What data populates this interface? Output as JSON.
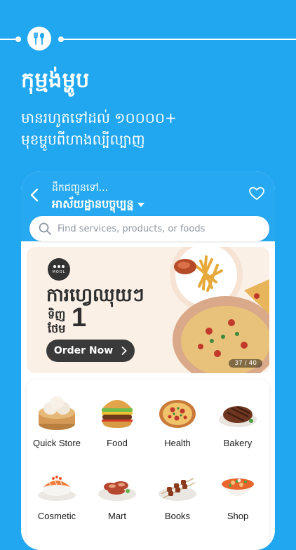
{
  "headline": "កុម្មង់ម្ហូប",
  "subtitle_line1": "មានរហូតទៅដល់ ១០០០០+",
  "subtitle_line2": "មុខម្ហូបពីហាងល្បីល្បាញ",
  "header": {
    "deliver_label": "ដឹកជញ្ជូនទៅ...",
    "address": "អាស័យដ្ឋានបច្ចុប្បន្ន"
  },
  "search": {
    "placeholder": "Find services, products, or foods"
  },
  "banner": {
    "brand": "MOOL",
    "title": "ការហ្វេឈុយៗ",
    "buy_label": "ទិញ",
    "free_label": "ថែម",
    "free_count": "1",
    "button_label": "Order Now",
    "page_counter": "37 / 40"
  },
  "categories": [
    {
      "label": "Quick Store",
      "icon": "dumpling-basket-icon"
    },
    {
      "label": "Food",
      "icon": "burger-icon"
    },
    {
      "label": "Health",
      "icon": "pizza-icon"
    },
    {
      "label": "Bakery",
      "icon": "steak-icon"
    },
    {
      "label": "Cosmetic",
      "icon": "sushi-icon"
    },
    {
      "label": "Mart",
      "icon": "roast-meat-icon"
    },
    {
      "label": "Books",
      "icon": "skewers-icon"
    },
    {
      "label": "Shop",
      "icon": "soup-bowl-icon"
    }
  ],
  "colors": {
    "background": "#21a6f0",
    "header": "#27a9f1",
    "banner": "#fbf0e6",
    "button": "#3a3a3a"
  }
}
